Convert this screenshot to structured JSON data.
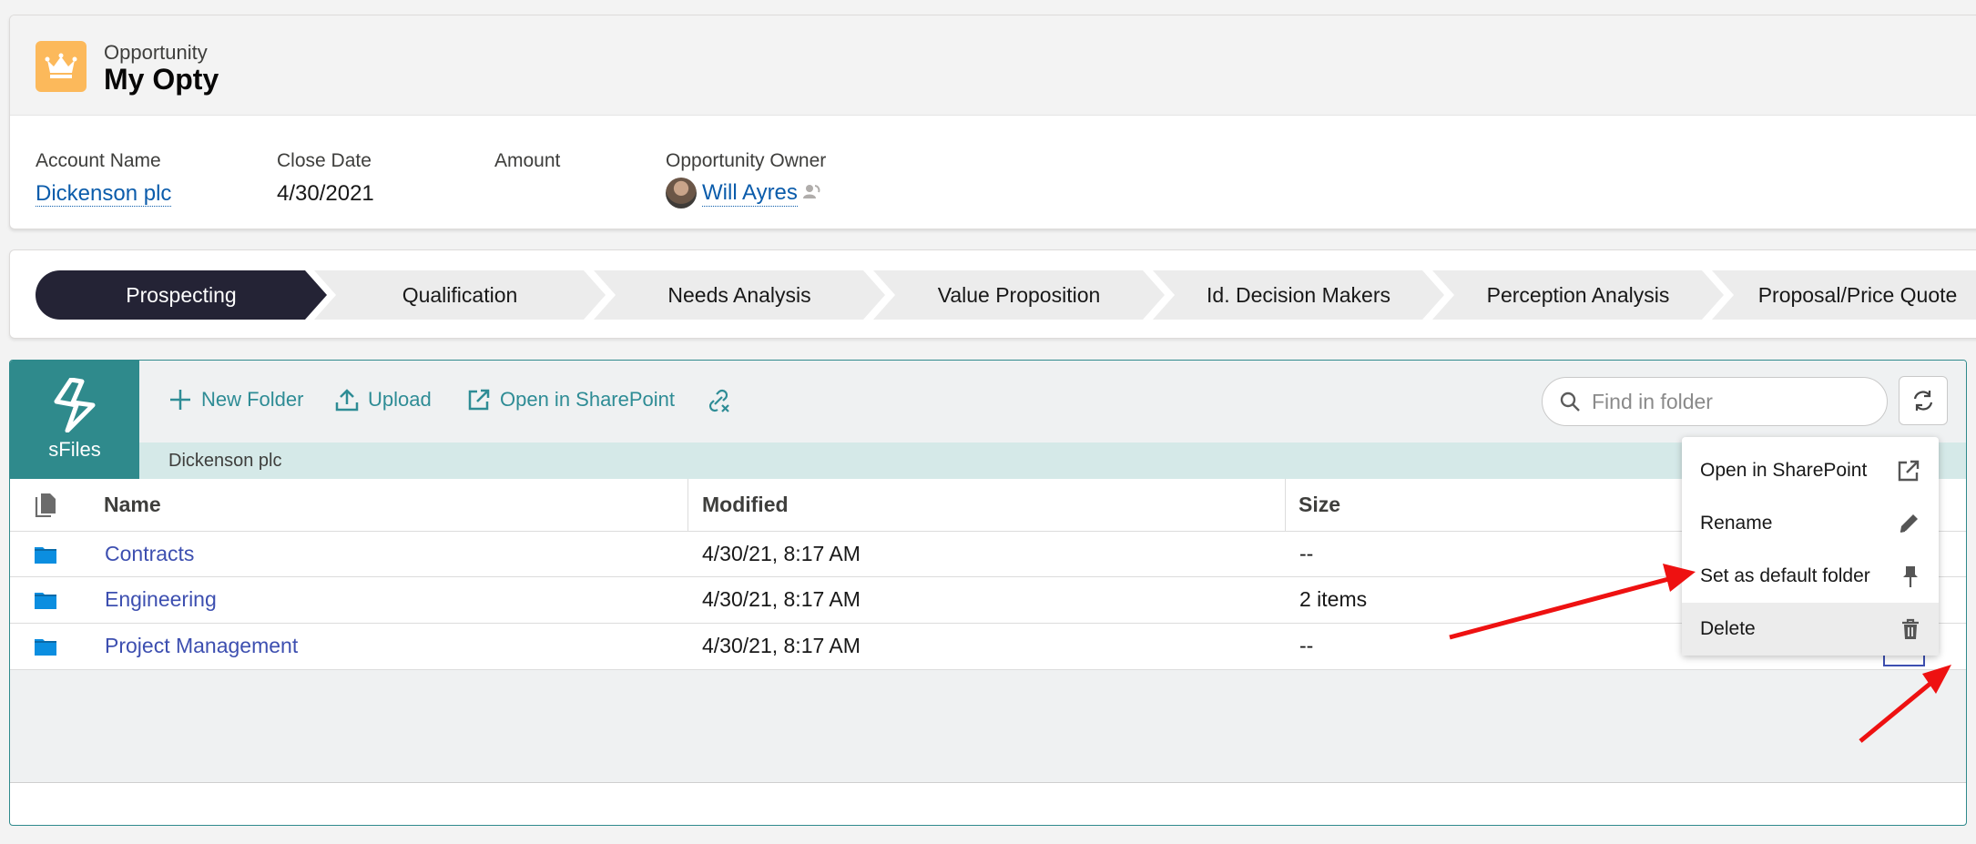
{
  "record": {
    "object_label": "Opportunity",
    "name": "My Opty",
    "fields": {
      "account_label": "Account Name",
      "account_value": "Dickenson plc",
      "close_date_label": "Close Date",
      "close_date_value": "4/30/2021",
      "amount_label": "Amount",
      "owner_label": "Opportunity Owner",
      "owner_value": "Will Ayres"
    }
  },
  "path": {
    "stages": [
      "Prospecting",
      "Qualification",
      "Needs Analysis",
      "Value Proposition",
      "Id. Decision Makers",
      "Perception Analysis",
      "Proposal/Price Quote"
    ],
    "current": "Prospecting"
  },
  "sfiles": {
    "logo_text": "sFiles",
    "toolbar": {
      "new_folder": "New Folder",
      "upload": "Upload",
      "open_sharepoint": "Open in SharePoint"
    },
    "search_placeholder": "Find in folder",
    "breadcrumb": "Dickenson plc",
    "columns": {
      "name": "Name",
      "modified": "Modified",
      "size": "Size"
    },
    "rows": [
      {
        "name": "Contracts",
        "modified": "4/30/21, 8:17 AM",
        "size": "--"
      },
      {
        "name": "Engineering",
        "modified": "4/30/21, 8:17 AM",
        "size": "2 items"
      },
      {
        "name": "Project Management",
        "modified": "4/30/21, 8:17 AM",
        "size": "--"
      }
    ],
    "menu": [
      {
        "label": "Open in SharePoint",
        "icon": "external-link-icon"
      },
      {
        "label": "Rename",
        "icon": "pencil-icon"
      },
      {
        "label": "Set as default folder",
        "icon": "pin-icon"
      },
      {
        "label": "Delete",
        "icon": "trash-icon"
      }
    ]
  },
  "colors": {
    "accent_teal": "#2f8a8c",
    "path_active": "#242335",
    "link_blue": "#0b5cab",
    "folder_blue": "#0b8ee0",
    "annotation_red": "#ee1111"
  }
}
